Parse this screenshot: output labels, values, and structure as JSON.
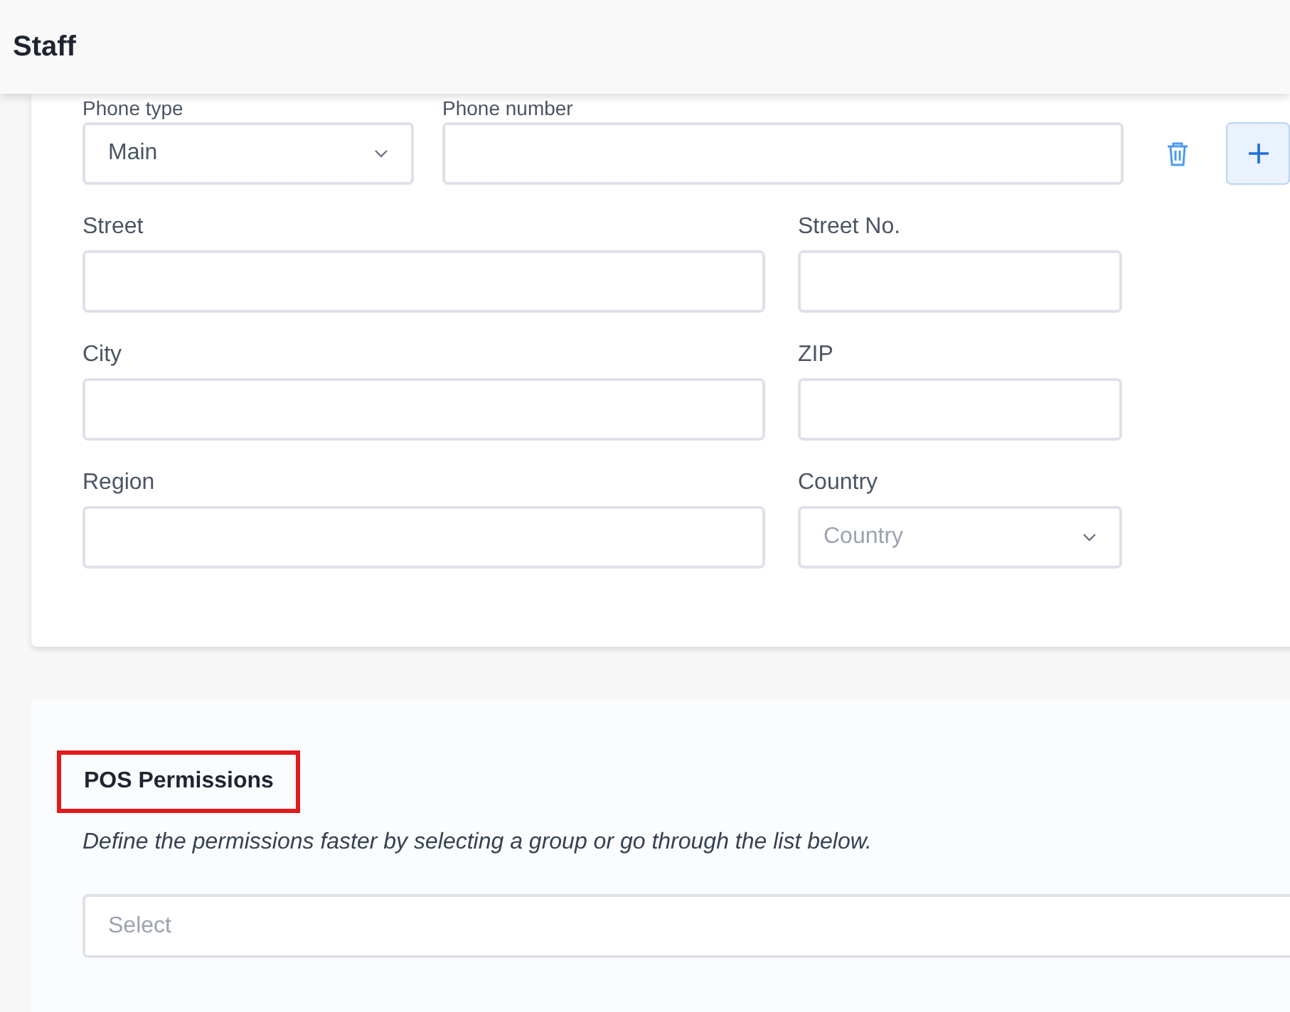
{
  "header": {
    "title": "Staff"
  },
  "phone": {
    "type_label": "Phone type",
    "type_value": "Main",
    "number_label": "Phone number"
  },
  "address_fields": [
    {
      "label": "Street",
      "kind": "text"
    },
    {
      "label": "Street No.",
      "kind": "text"
    },
    {
      "label": "City",
      "kind": "text"
    },
    {
      "label": "ZIP",
      "kind": "text"
    },
    {
      "label": "Region",
      "kind": "text"
    },
    {
      "label": "Country",
      "kind": "select",
      "placeholder": "Country"
    }
  ],
  "permissions": {
    "title": "POS Permissions",
    "highlighted": true,
    "description": "Define the permissions faster by selecting a group or go through the list below.",
    "select_placeholder": "Select"
  }
}
